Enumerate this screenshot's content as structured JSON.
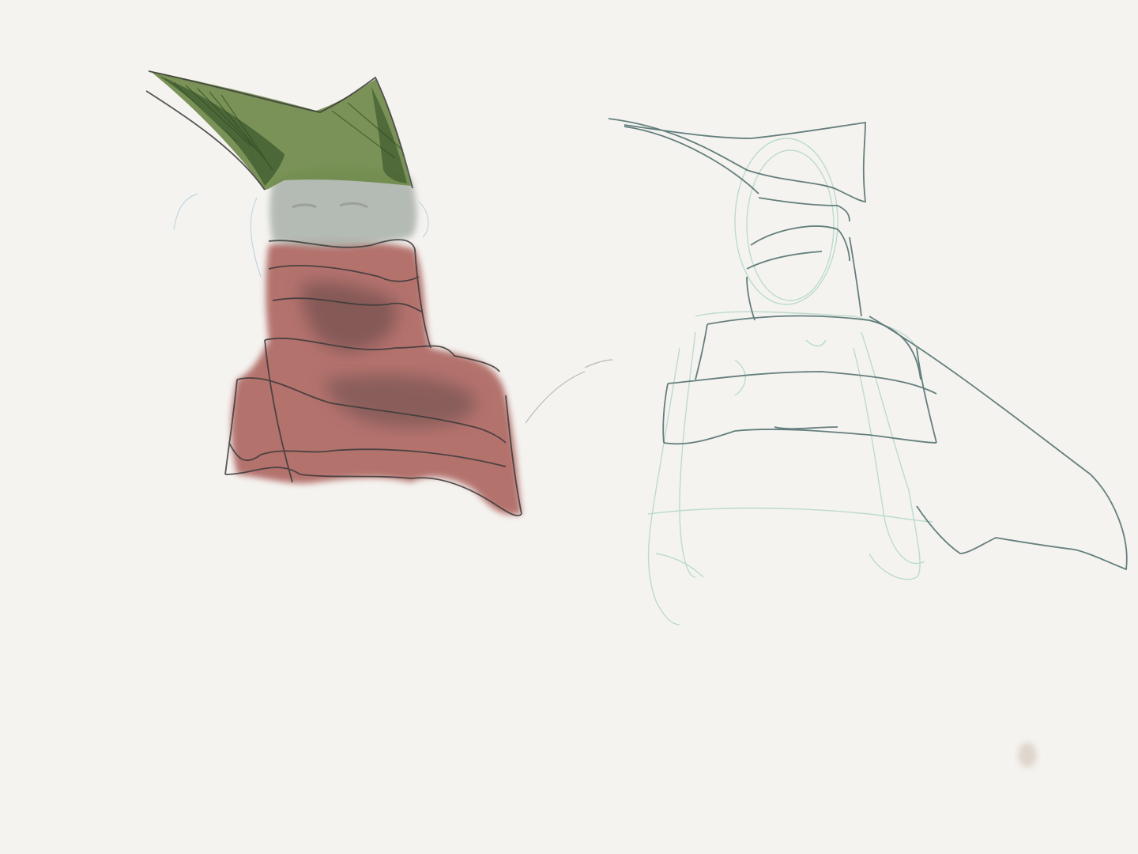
{
  "canvas": {
    "background": "#f5f3f0",
    "description_items": [
      "painted-figure",
      "outline-sketch"
    ]
  },
  "colors": {
    "hat_green": "#6f8a4a",
    "hat_dark": "#3f5a2e",
    "face_gray": "#b8beb6",
    "scarf_red": "#a2504a",
    "scarf_shadow": "#6b4a4a",
    "line_dark": "#3a3a3a",
    "sketch_green": "#a9d3c1",
    "sketch_dark": "#4a6b6a",
    "smudge": "#d9cfc4"
  }
}
